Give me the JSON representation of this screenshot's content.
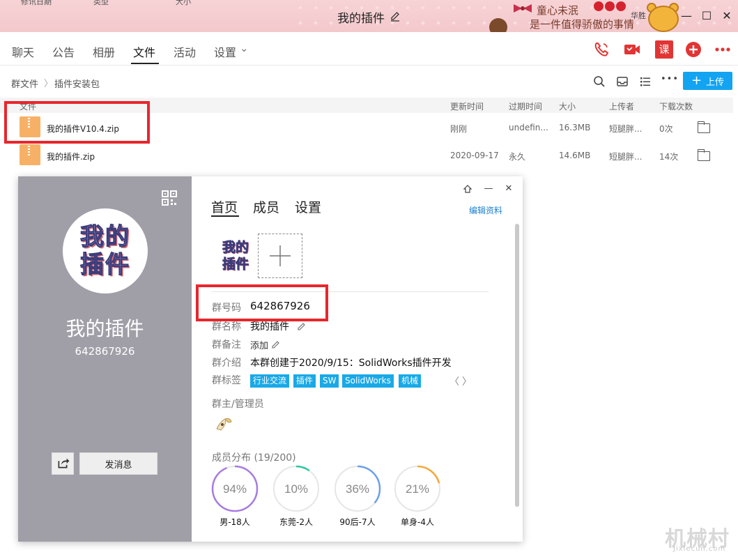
{
  "window": {
    "title": "我的插件",
    "top_strip": [
      "修讯日期",
      "类型",
      "大小"
    ],
    "deco_line1": "童心未泯",
    "deco_line2": "是一件值得骄傲的事情",
    "skin_label": "华胜",
    "minimize": "—",
    "maximize": "☐",
    "close": "✕"
  },
  "nav": {
    "tabs": [
      "聊天",
      "公告",
      "相册",
      "文件",
      "活动",
      "设置"
    ],
    "active_tab": "文件",
    "settings_caret": "⌄",
    "icons": {
      "call": "phone-icon",
      "video": "video-call-icon",
      "course": "课",
      "add": "add-icon",
      "more": "more-icon"
    },
    "colors": {
      "accent": "#e13535"
    }
  },
  "breadcrumb": {
    "root": "群文件",
    "sep": "〉",
    "current": "插件安装包"
  },
  "toolbar": {
    "upload_label": "上传",
    "upload_plus": "+",
    "more": "•••"
  },
  "file_table": {
    "headers": [
      "文件",
      "更新时间",
      "过期时间",
      "大小",
      "上传者",
      "下载次数"
    ],
    "rows": [
      {
        "name": "我的插件V10.4.zip",
        "updated": "刚刚",
        "expires": "undefin...",
        "size": "16.3MB",
        "uploader": "短腿胖...",
        "downloads": "0次"
      },
      {
        "name": "我的插件.zip",
        "updated": "2020-09-17",
        "expires": "永久",
        "size": "14.6MB",
        "uploader": "短腿胖...",
        "downloads": "14次"
      }
    ]
  },
  "group_card": {
    "avatar_line1": "我的",
    "avatar_line2": "插件",
    "name": "我的插件",
    "number": "642867926",
    "send_message": "发消息",
    "tabs": [
      "首页",
      "成员",
      "设置"
    ],
    "edit_profile": "编辑资料",
    "photo_line1": "我的",
    "photo_line2": "插件",
    "add_photo": "+",
    "fields": {
      "number_label": "群号码",
      "number_value": "642867926",
      "name_label": "群名称",
      "name_value": "我的插件",
      "remark_label": "群备注",
      "remark_value": "添加",
      "intro_label": "群介绍",
      "intro_value": "本群创建于2020/9/15：SolidWorks插件开发",
      "tags_label": "群标签"
    },
    "tags": [
      "行业交流",
      "插件",
      "SW",
      "SolidWorks",
      "机械"
    ],
    "tag_prev": "〈",
    "tag_next": "〉",
    "admins_label": "群主/管理员",
    "distribution_title": "成员分布 (19/200)",
    "distribution": [
      {
        "percent": 94,
        "text": "94%",
        "label": "男-18人",
        "color": "#a77be0"
      },
      {
        "percent": 10,
        "text": "10%",
        "label": "东莞-2人",
        "color": "#2fc6a2"
      },
      {
        "percent": 36,
        "text": "36%",
        "label": "90后-7人",
        "color": "#6c9fe8"
      },
      {
        "percent": 21,
        "text": "21%",
        "label": "单身-4人",
        "color": "#f2a93b"
      }
    ]
  },
  "watermark": {
    "line1": "机械村",
    "line2": "Jixiecun.com"
  }
}
